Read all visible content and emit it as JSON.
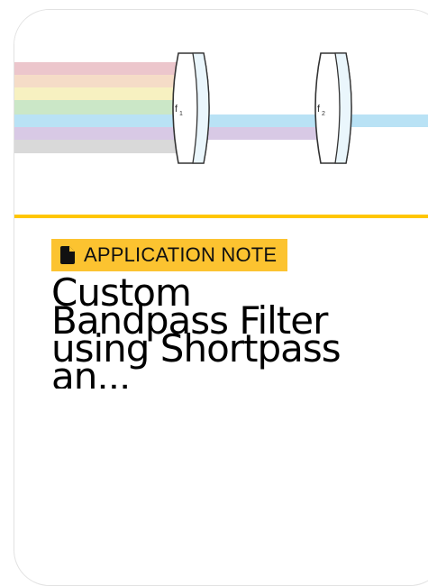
{
  "card": {
    "figure": {
      "lens_1_label": "f",
      "lens_1_subscript": "1",
      "lens_2_label": "f",
      "lens_2_subscript": "2",
      "colors": {
        "beam_red": "#ecc6cc",
        "beam_orange": "#f5dcc7",
        "beam_yellow": "#f7f1c1",
        "beam_green": "#cbe7c7",
        "beam_blue": "#b9e2f5",
        "beam_violet": "#d8c9e5",
        "beam_gray": "#d9d9d9",
        "lens_stroke": "#333333"
      }
    },
    "accent_color": "#ffc600",
    "badge": {
      "icon": "document-icon",
      "label": "APPLICATION NOTE",
      "background": "#fcc330"
    },
    "title": "Custom Bandpass Filter using Shortpass an..."
  }
}
